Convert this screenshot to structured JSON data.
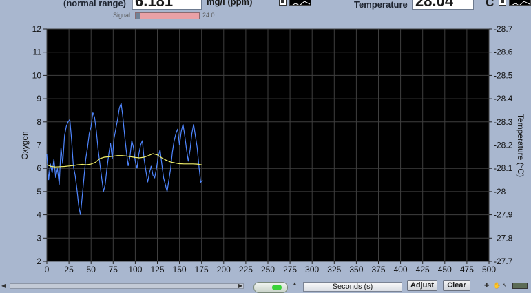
{
  "header": {
    "oxygen_label": "(normal range)",
    "oxygen_value": "6.181",
    "oxygen_unit": "mg/l (ppm)",
    "signal_label": "Signal",
    "signal_value": "24.0",
    "signal_fraction": 0.06,
    "temperature_label": "Temperature",
    "temperature_value": "28.04",
    "temperature_unit": "C"
  },
  "footer": {
    "adjust_label": "Adjust",
    "clear_label": "Clear",
    "seconds_label": "Seconds (s)"
  },
  "colors": {
    "oxygen_series": "#4f86ff",
    "temperature_series": "#f1f06a",
    "plot_background": "#000000",
    "grid": "#3f3f3f"
  },
  "chart_data": {
    "type": "line",
    "xlabel": "",
    "ylabel": "Oxygen",
    "y2label": "Temperature (°C)",
    "xlim": [
      0,
      500
    ],
    "ylim": [
      2,
      12
    ],
    "y2lim": [
      27.7,
      28.7
    ],
    "xticks": [
      0,
      25,
      50,
      75,
      100,
      125,
      150,
      175,
      200,
      225,
      250,
      275,
      300,
      325,
      350,
      375,
      400,
      425,
      450,
      475,
      500
    ],
    "yticks": [
      2,
      3,
      4,
      5,
      6,
      7,
      8,
      9,
      10,
      11,
      12
    ],
    "y2ticks": [
      "27.7",
      "27.8",
      "27.9",
      "28",
      "28.1",
      "28.2",
      "28.3",
      "28.4",
      "28.5",
      "28.6",
      "28.7"
    ],
    "grid": true,
    "series": [
      {
        "axis": "left",
        "color": "#4f86ff",
        "x": [
          0,
          2,
          4,
          6,
          8,
          10,
          12,
          14,
          16,
          18,
          20,
          22,
          24,
          26,
          28,
          30,
          32,
          34,
          36,
          38,
          40,
          42,
          44,
          46,
          48,
          50,
          52,
          54,
          56,
          58,
          60,
          62,
          64,
          66,
          68,
          70,
          72,
          74,
          76,
          78,
          80,
          82,
          84,
          86,
          88,
          90,
          92,
          94,
          96,
          98,
          100,
          102,
          104,
          106,
          108,
          110,
          112,
          114,
          116,
          118,
          120,
          122,
          124,
          126,
          128,
          130,
          132,
          134,
          136,
          138,
          140,
          142,
          144,
          146,
          148,
          150,
          152,
          154,
          156,
          158,
          160,
          162,
          164,
          166,
          168,
          170,
          172,
          174,
          176
        ],
        "y": [
          6.6,
          5.5,
          6.2,
          5.8,
          6.4,
          5.6,
          6.0,
          5.3,
          6.9,
          6.2,
          7.4,
          7.8,
          8.0,
          8.1,
          7.2,
          6.1,
          5.7,
          5.1,
          4.4,
          4.0,
          4.8,
          5.6,
          6.4,
          6.9,
          7.5,
          7.8,
          8.4,
          8.2,
          7.6,
          6.8,
          6.2,
          5.6,
          5.0,
          5.3,
          6.0,
          6.6,
          7.1,
          6.4,
          7.3,
          7.7,
          8.1,
          8.6,
          8.8,
          8.2,
          7.4,
          6.7,
          6.1,
          6.5,
          7.2,
          6.9,
          6.3,
          6.0,
          6.6,
          7.0,
          7.2,
          6.4,
          5.9,
          5.4,
          5.8,
          6.1,
          5.7,
          5.6,
          6.0,
          6.5,
          6.8,
          6.2,
          5.6,
          5.3,
          5.0,
          5.5,
          6.0,
          6.7,
          7.2,
          7.5,
          7.7,
          7.0,
          7.6,
          7.9,
          7.4,
          6.8,
          6.3,
          6.8,
          7.5,
          7.9,
          7.4,
          6.9,
          6.1,
          5.4,
          5.5
        ]
      },
      {
        "axis": "right",
        "color": "#f1f06a",
        "x": [
          0,
          5,
          10,
          15,
          20,
          25,
          30,
          35,
          40,
          45,
          50,
          55,
          60,
          65,
          70,
          75,
          80,
          85,
          90,
          95,
          100,
          105,
          110,
          115,
          120,
          125,
          130,
          135,
          140,
          145,
          150,
          155,
          160,
          165,
          170,
          175
        ],
        "y": [
          28.115,
          28.108,
          28.106,
          28.107,
          28.108,
          28.11,
          28.112,
          28.115,
          28.117,
          28.115,
          28.118,
          28.126,
          28.142,
          28.148,
          28.15,
          28.152,
          28.155,
          28.155,
          28.153,
          28.15,
          28.147,
          28.145,
          28.148,
          28.155,
          28.163,
          28.158,
          28.145,
          28.135,
          28.127,
          28.123,
          28.12,
          28.119,
          28.119,
          28.119,
          28.118,
          28.115
        ]
      }
    ]
  }
}
